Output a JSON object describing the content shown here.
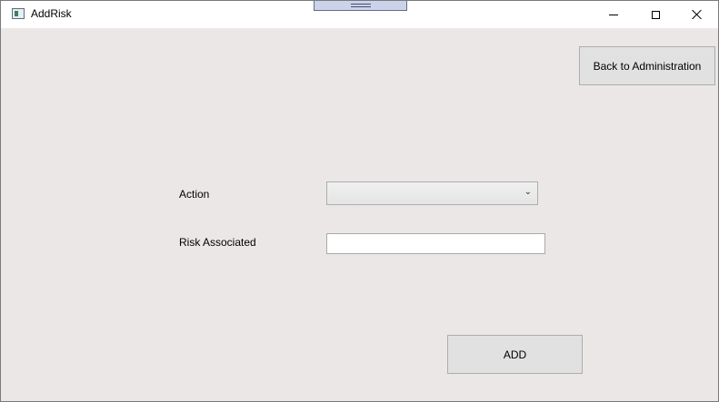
{
  "window": {
    "title": "AddRisk",
    "icon": "window-app-icon",
    "controls": {
      "minimize": "minimize-icon",
      "maximize": "maximize-icon",
      "close": "close-icon"
    }
  },
  "header": {
    "back_label": "Back to Administration"
  },
  "form": {
    "action_label": "Action",
    "action_value": "",
    "action_arrow": "⌄",
    "risk_label": "Risk Associated",
    "risk_value": "",
    "add_label": "ADD"
  },
  "colors": {
    "window_bg": "#ebe7e6",
    "button_bg": "#e1e1e1",
    "titlebar_bg": "#ffffff"
  }
}
